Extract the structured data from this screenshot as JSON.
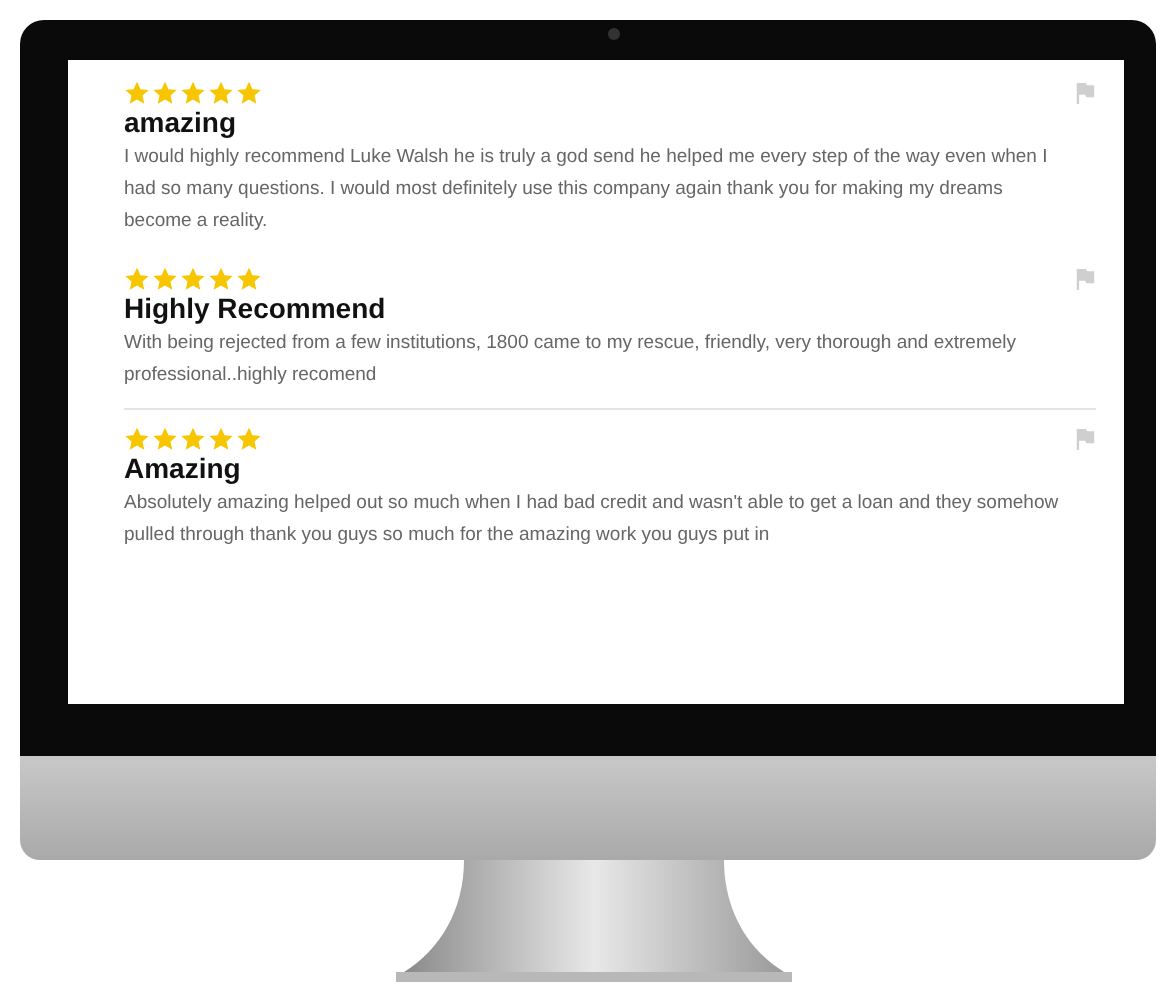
{
  "reviews": [
    {
      "stars": 5,
      "title": "amazing",
      "body": "I would highly recommend Luke Walsh he is truly a god send he helped me every step of the way even when I had so many questions. I would most definitely use this company again thank you for making my dreams become a reality."
    },
    {
      "stars": 5,
      "title": "Highly Recommend",
      "body": "With being rejected from a few institutions, 1800 came to my rescue, friendly, very thorough and extremely professional..highly recomend"
    },
    {
      "stars": 5,
      "title": "Amazing",
      "body": "Absolutely amazing helped out so much when I had bad credit and wasn't able to get a loan and they somehow pulled through thank you guys so much for the amazing work you guys put in"
    }
  ]
}
